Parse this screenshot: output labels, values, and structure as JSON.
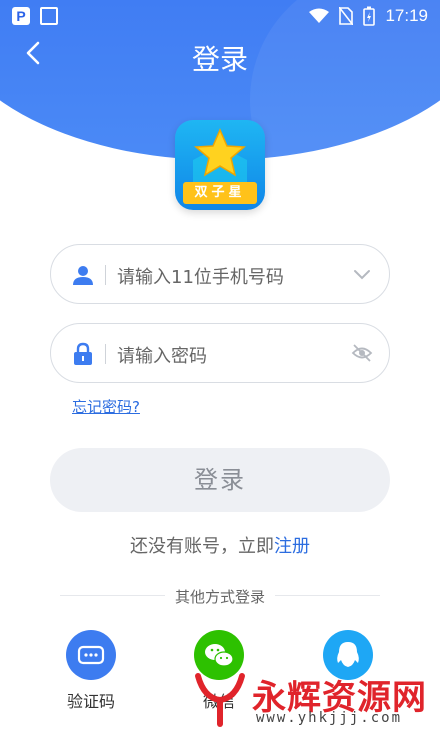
{
  "status_bar": {
    "time": "17:19"
  },
  "header": {
    "title": "登录"
  },
  "logo": {
    "label": "双子星"
  },
  "form": {
    "phone_placeholder": "请输入11位手机号码",
    "password_placeholder": "请输入密码",
    "forgot_label": "忘记密码?",
    "login_label": "登录",
    "register_prompt": "还没有账号，立即",
    "register_link": "注册"
  },
  "other_login": {
    "title": "其他方式登录",
    "methods": [
      {
        "label": "验证码",
        "icon": "sms-code-icon",
        "color": "#3d7cf0"
      },
      {
        "label": "微信",
        "icon": "wechat-icon",
        "color": "#2dc100"
      },
      {
        "label": "",
        "icon": "qq-icon",
        "color": "#1ea7f5"
      }
    ]
  },
  "watermark": {
    "text": "永辉资源网",
    "url": "www.yhkjjj.com"
  },
  "colors": {
    "primary": "#2c63e8",
    "link": "#2c6de0",
    "button_disabled": "#eef0f4"
  }
}
